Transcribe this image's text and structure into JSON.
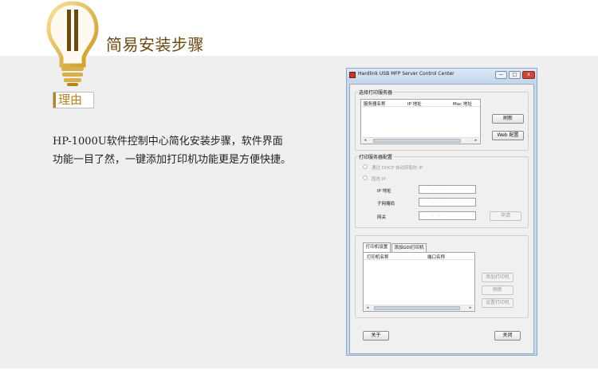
{
  "header": {
    "title": "简易安装步骤",
    "reason_tag": "理由"
  },
  "description": "HP-1000U软件控制中心简化安装步骤，软件界面功能一目了然，一键添加打印机功能更是方便快捷。",
  "window": {
    "app_icon": "hardlink-app-icon",
    "title": "Hardlink USB MFP Server Control Center",
    "controls": {
      "minimize": "—",
      "maximize": "□",
      "close": "x"
    },
    "select_server": {
      "group_label": "选择打印服务器",
      "columns": [
        "服务器名称",
        "IP 地址",
        "Mac 地址"
      ],
      "refresh_label": "刷新",
      "web_config_label": "Web 配置"
    },
    "server_config": {
      "group_label": "打印服务器配置",
      "dhcp_label": "通过 DHCP 自动获取的 IP",
      "static_label": "固态 IP",
      "ip_label": "IP 地址",
      "subnet_label": "子网掩码",
      "gateway_label": "网关",
      "ip_value": ".   .   .",
      "subnet_value": ".   .   .",
      "gateway_value": ".   .   .",
      "apply_label": "申请"
    },
    "printer_tabs": {
      "tabs": [
        "打印机设置",
        "添加GDI打印机"
      ],
      "columns": [
        "打印机名称",
        "端口名称"
      ],
      "add_printer_label": "添加打印机",
      "refresh_label": "刷新",
      "setup_printer_label": "设置打印机"
    },
    "about_label": "关于",
    "close_label": "关闭"
  }
}
